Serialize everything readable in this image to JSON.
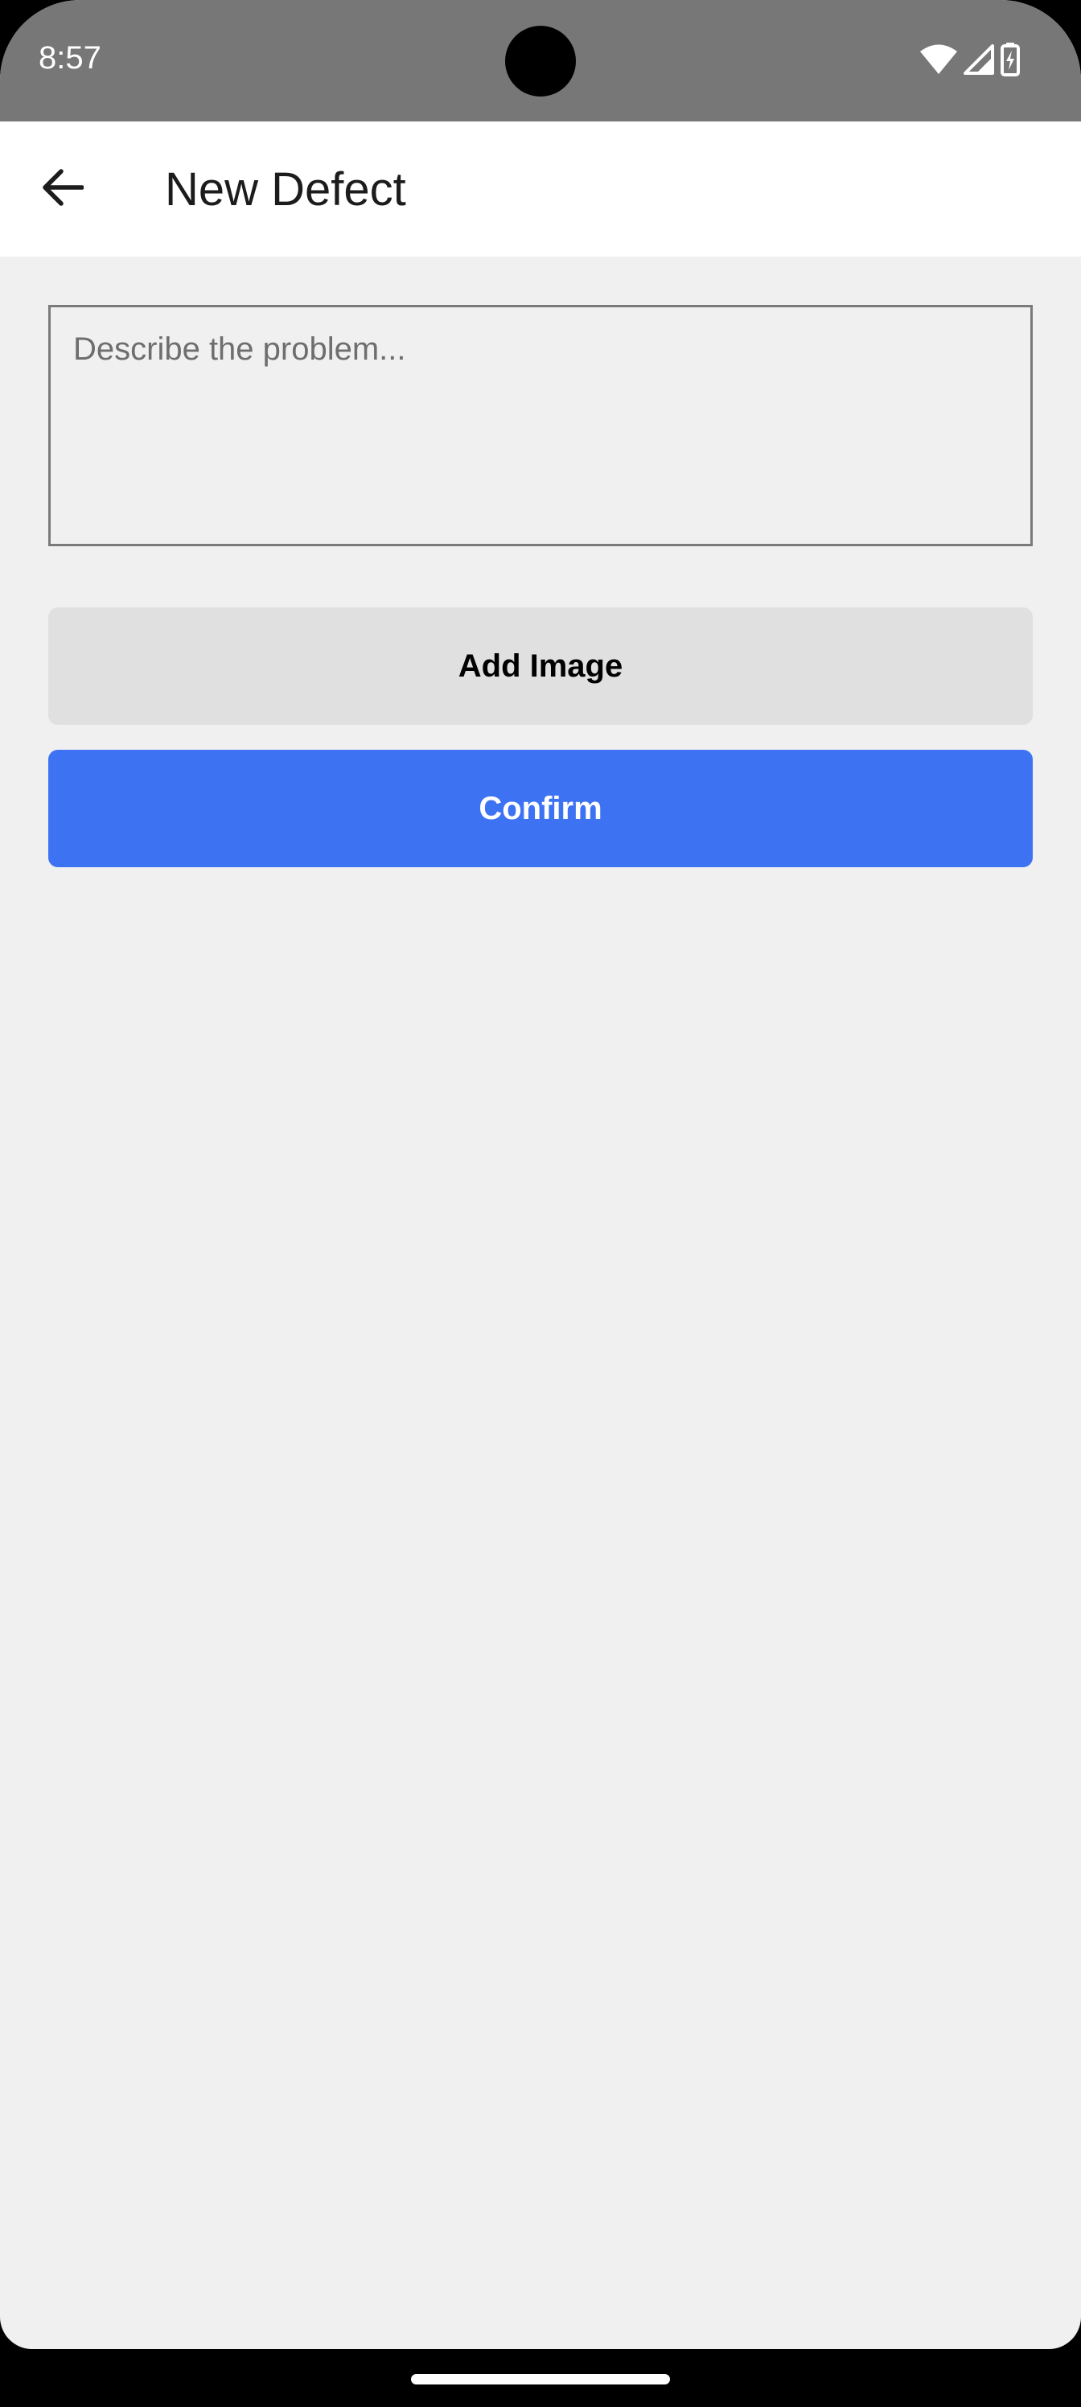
{
  "status_bar": {
    "time": "8:57",
    "icons": [
      "wifi-icon",
      "cellular-signal-icon",
      "battery-charging-icon"
    ]
  },
  "app_bar": {
    "back_icon": "arrow-back-icon",
    "title": "New Defect"
  },
  "form": {
    "description": {
      "value": "",
      "placeholder": "Describe the problem..."
    },
    "add_image_label": "Add Image",
    "confirm_label": "Confirm"
  },
  "colors": {
    "status_bar": "#777777",
    "app_bar": "#ffffff",
    "background": "#f0f0f0",
    "add_image_button": "#e0e0e0",
    "confirm_button": "#3d73f2",
    "confirm_text": "#ffffff"
  }
}
